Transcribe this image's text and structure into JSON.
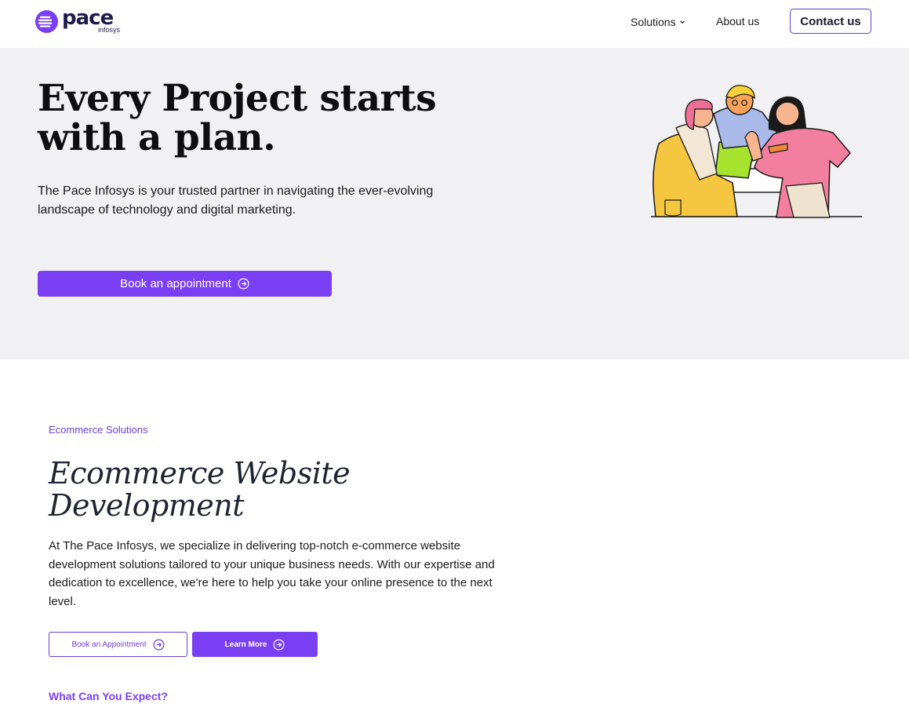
{
  "brand": {
    "name": "pace",
    "sub": "infosys",
    "accent": "#7a3ff2",
    "logo_icon": "pace-logo-icon"
  },
  "nav": {
    "solutions": "Solutions",
    "about": "About us",
    "contact": "Contact us",
    "solutions_icon": "chevron-down-icon"
  },
  "hero": {
    "title_line1": "Every Project starts",
    "title_line2": "with a plan.",
    "description": "The Pace Infosys is your trusted partner in navigating the ever-evolving landscape of technology and digital marketing.",
    "cta": "Book an appointment",
    "cta_icon": "circle-arrow-right-icon",
    "background": "#f1f1f3",
    "illustration": "team-collaboration-illustration"
  },
  "ecommerce": {
    "eyebrow": "Ecommerce Solutions",
    "title_line1": "Ecommerce Website",
    "title_line2": "Development",
    "description": "At The Pace Infosys, we specialize in delivering top-notch e-commerce website development solutions tailored to your unique business needs. With our expertise and dedication to excellence, we're here to help you take your online presence to the next level.",
    "btn_appointment": "Book an Appointment",
    "btn_learn": "Learn More",
    "expect_heading": "What Can You Expect?"
  }
}
